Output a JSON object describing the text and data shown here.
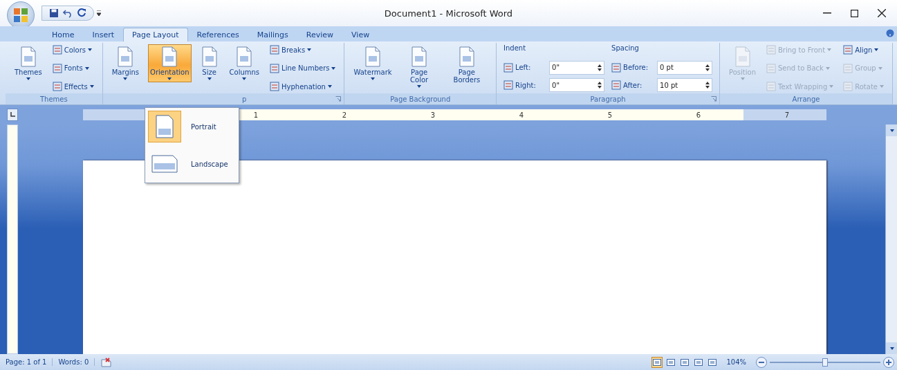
{
  "window": {
    "title": "Document1 - Microsoft Word"
  },
  "tabs": [
    {
      "label": "Home",
      "selected": false
    },
    {
      "label": "Insert",
      "selected": false
    },
    {
      "label": "Page Layout",
      "selected": true
    },
    {
      "label": "References",
      "selected": false
    },
    {
      "label": "Mailings",
      "selected": false
    },
    {
      "label": "Review",
      "selected": false
    },
    {
      "label": "View",
      "selected": false
    }
  ],
  "ribbon": {
    "groups": [
      {
        "label": "Themes",
        "launcher": false,
        "columns": [
          [
            {
              "kind": "large",
              "label": "Themes",
              "dropdown": true,
              "pressed": false,
              "disabled": false
            }
          ],
          [
            {
              "kind": "small",
              "label": "Colors",
              "dropdown": true,
              "disabled": false
            },
            {
              "kind": "small",
              "label": "Fonts",
              "dropdown": true,
              "disabled": false
            },
            {
              "kind": "small",
              "label": "Effects",
              "dropdown": true,
              "disabled": false
            }
          ]
        ]
      },
      {
        "label": "p",
        "launcher": true,
        "columns": [
          [
            {
              "kind": "large",
              "label": "Margins",
              "dropdown": true,
              "pressed": false,
              "disabled": false
            }
          ],
          [
            {
              "kind": "large",
              "label": "Orientation",
              "dropdown": true,
              "pressed": true,
              "disabled": false
            }
          ],
          [
            {
              "kind": "large",
              "label": "Size",
              "dropdown": true,
              "pressed": false,
              "disabled": false
            }
          ],
          [
            {
              "kind": "large",
              "label": "Columns",
              "dropdown": true,
              "pressed": false,
              "disabled": false
            }
          ],
          [
            {
              "kind": "small",
              "label": "Breaks",
              "dropdown": true,
              "disabled": false
            },
            {
              "kind": "small",
              "label": "Line Numbers",
              "dropdown": true,
              "disabled": false
            },
            {
              "kind": "small",
              "label": "Hyphenation",
              "dropdown": true,
              "disabled": false
            }
          ]
        ]
      },
      {
        "label": "Page Background",
        "launcher": false,
        "columns": [
          [
            {
              "kind": "large",
              "label": "Watermark",
              "dropdown": true,
              "pressed": false,
              "disabled": false
            }
          ],
          [
            {
              "kind": "large",
              "label": "Page Color",
              "dropdown": true,
              "pressed": false,
              "disabled": false
            }
          ],
          [
            {
              "kind": "large",
              "label": "Page Borders",
              "dropdown": false,
              "pressed": false,
              "disabled": false
            }
          ]
        ]
      },
      {
        "label": "Paragraph",
        "launcher": true,
        "columns": [
          [
            {
              "kind": "heading",
              "label": "Indent"
            },
            {
              "kind": "spin",
              "label": "Left:",
              "value": "0\""
            },
            {
              "kind": "spin",
              "label": "Right:",
              "value": "0\""
            }
          ],
          [
            {
              "kind": "heading",
              "label": "Spacing"
            },
            {
              "kind": "spin",
              "label": "Before:",
              "value": "0 pt"
            },
            {
              "kind": "spin",
              "label": "After:",
              "value": "10 pt"
            }
          ]
        ]
      },
      {
        "label": "Arrange",
        "launcher": false,
        "columns": [
          [
            {
              "kind": "large",
              "label": "Position",
              "dropdown": true,
              "pressed": false,
              "disabled": true
            }
          ],
          [
            {
              "kind": "small",
              "label": "Bring to Front",
              "dropdown": true,
              "disabled": true
            },
            {
              "kind": "small",
              "label": "Send to Back",
              "dropdown": true,
              "disabled": true
            },
            {
              "kind": "small",
              "label": "Text Wrapping",
              "dropdown": true,
              "disabled": true
            }
          ],
          [
            {
              "kind": "small",
              "label": "Align",
              "dropdown": true,
              "disabled": false
            },
            {
              "kind": "small",
              "label": "Group",
              "dropdown": true,
              "disabled": true
            },
            {
              "kind": "small",
              "label": "Rotate",
              "dropdown": true,
              "disabled": true
            }
          ]
        ]
      }
    ]
  },
  "ruler": {
    "labels": [
      "1",
      "2",
      "3",
      "4",
      "5",
      "6",
      "7"
    ]
  },
  "orientation_menu": [
    {
      "label": "Portrait",
      "selected": true
    },
    {
      "label": "Landscape",
      "selected": false
    }
  ],
  "status_bar": {
    "page": "Page: 1 of 1",
    "words": "Words: 0",
    "views": [
      {
        "selected": true
      },
      {
        "selected": false
      },
      {
        "selected": false
      },
      {
        "selected": false
      },
      {
        "selected": false
      }
    ],
    "zoom": "104%",
    "zoom_slider": {
      "level": 0.5
    }
  }
}
